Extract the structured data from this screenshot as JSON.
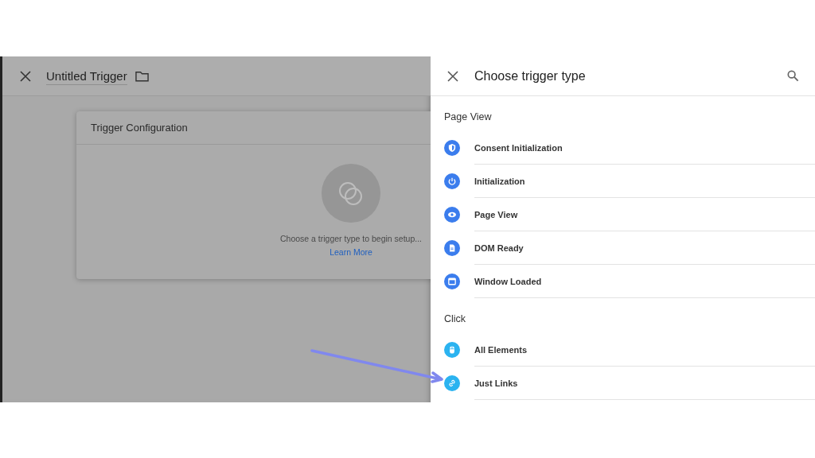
{
  "editor": {
    "title": "Untitled Trigger",
    "card": {
      "title": "Trigger Configuration",
      "message": "Choose a trigger type to begin setup...",
      "link": "Learn More"
    }
  },
  "picker": {
    "title": "Choose trigger type",
    "groups": [
      {
        "label": "Page View",
        "items": [
          {
            "label": "Consent Initialization",
            "color": "#3b7ded"
          },
          {
            "label": "Initialization",
            "color": "#3b7ded"
          },
          {
            "label": "Page View",
            "color": "#3b7ded"
          },
          {
            "label": "DOM Ready",
            "color": "#3b7ded"
          },
          {
            "label": "Window Loaded",
            "color": "#3b7ded"
          }
        ]
      },
      {
        "label": "Click",
        "items": [
          {
            "label": "All Elements",
            "color": "#2bb3f0"
          },
          {
            "label": "Just Links",
            "color": "#2bb3f0"
          }
        ]
      }
    ]
  }
}
